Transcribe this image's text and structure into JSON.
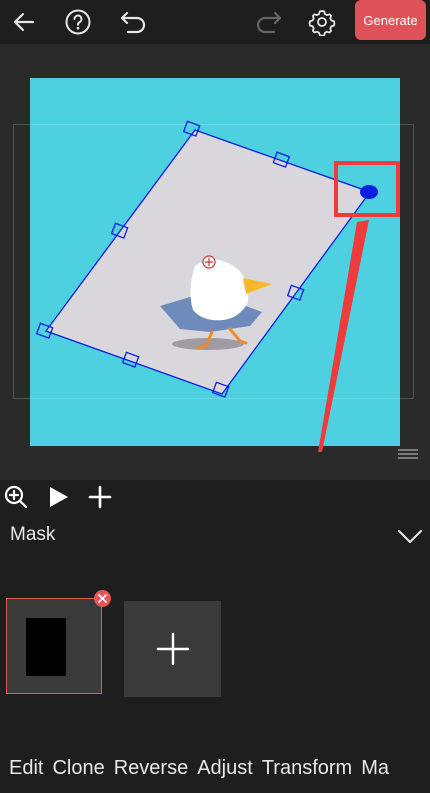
{
  "toolbar": {
    "back_icon": "arrow-left-icon",
    "help_icon": "question-circle-icon",
    "undo_icon": "undo-icon",
    "redo_icon": "redo-icon",
    "settings_icon": "gear-icon",
    "generate_label": "Generate",
    "generate_color": "#e0525a"
  },
  "canvas": {
    "background_color": "#4dd0df",
    "mask_fill_color": "#d9d7dc",
    "mask_outline_color": "#0a1ee0",
    "highlight_color": "#ef3b3b"
  },
  "timeline_tools": {
    "zoom_icon": "zoom-in-icon",
    "play_icon": "play-icon",
    "add_icon": "plus-icon"
  },
  "mask_section": {
    "title": "Mask",
    "toggle_icon": "chevron-down-icon",
    "remove_icon": "close-icon",
    "add_icon": "plus-icon"
  },
  "bottom_menu": {
    "items": [
      "Edit",
      "Clone",
      "Reverse",
      "Adjust",
      "Transform",
      "Ma"
    ]
  }
}
